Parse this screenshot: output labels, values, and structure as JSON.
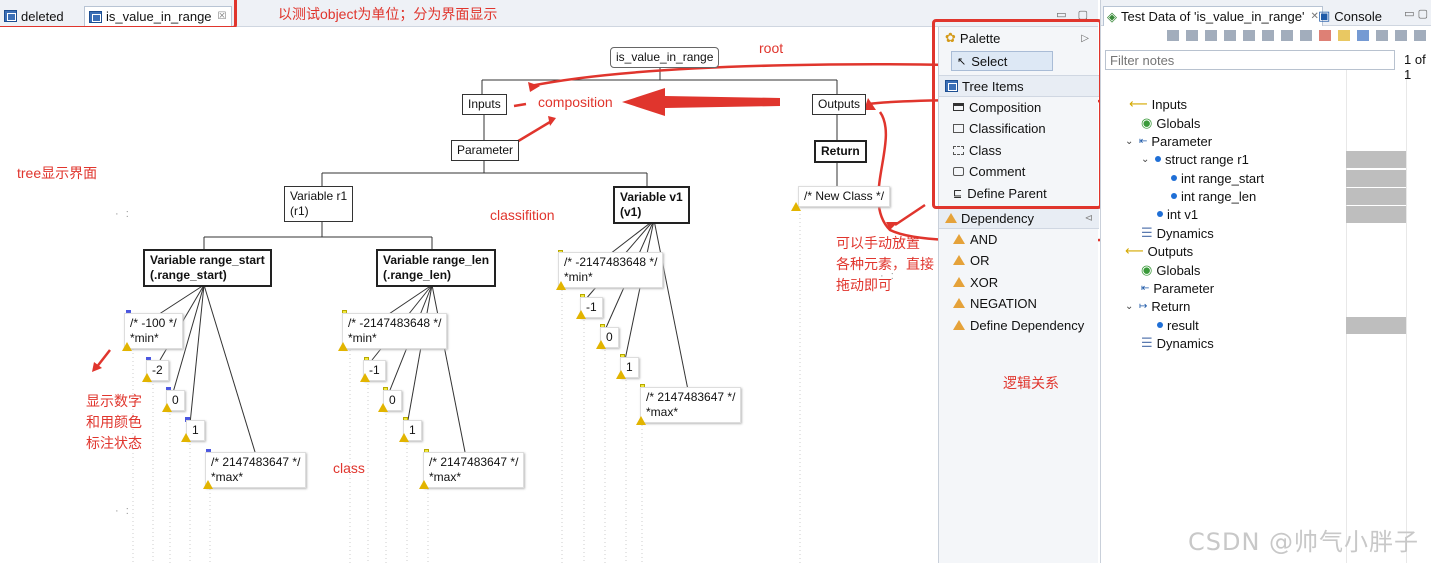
{
  "editor": {
    "tabs": [
      {
        "label": "deleted",
        "icon": "classification-tree-icon"
      },
      {
        "label": "is_value_in_range",
        "icon": "classification-tree-icon",
        "close": "☒"
      }
    ]
  },
  "tree": {
    "root": "is_value_in_range",
    "inputs": "Inputs",
    "outputs": "Outputs",
    "parameter": "Parameter",
    "return": "Return",
    "var_r1": [
      "Variable r1",
      "(r1)"
    ],
    "var_v1": [
      "Variable v1",
      "(v1)"
    ],
    "new_class": "/* New Class */",
    "var_range_start": [
      "Variable range_start",
      "(.range_start)"
    ],
    "var_range_len": [
      "Variable range_len",
      "(.range_len)"
    ],
    "rs_classes": [
      "/* -100 */",
      "*min*",
      "-2",
      "0",
      "1",
      "/* 2147483647 */",
      "*max*"
    ],
    "rl_classes": [
      "/* -2147483648 */",
      "*min*",
      "-1",
      "0",
      "1",
      "/* 2147483647 */",
      "*max*"
    ],
    "v1_classes": [
      "/* -2147483648 */",
      "*min*",
      "-1",
      "0",
      "1",
      "/* 2147483647 */",
      "*max*"
    ]
  },
  "annotations": {
    "title_note": "以测试object为单位；分为界面显示",
    "root": "root",
    "composition": "composition",
    "tree_ui": "tree显示界面",
    "classification": "classifition",
    "class": "class",
    "numbers": [
      "显示数字",
      "和用颜色",
      "标注状态"
    ],
    "drag": [
      "可以手动放置",
      "各种元素，直接",
      "拖动即可"
    ],
    "logic": "逻辑关系"
  },
  "palette": {
    "title": "Palette",
    "select": "Select",
    "tree_items_title": "Tree Items",
    "tree_items": [
      "Composition",
      "Classification",
      "Class",
      "Comment",
      "Define Parent"
    ],
    "dependency_title": "Dependency",
    "dependency_items": [
      "AND",
      "OR",
      "XOR",
      "NEGATION",
      "Define Dependency"
    ]
  },
  "test_data": {
    "tab_label": "Test Data of 'is_value_in_range'",
    "console_label": "Console",
    "filter_placeholder": "Filter notes",
    "page": "1 of 1",
    "rows": [
      "Inputs",
      "Globals",
      "Parameter",
      "struct range r1",
      "int range_start",
      "int range_len",
      "int v1",
      "Dynamics",
      "Outputs",
      "Globals",
      "Parameter",
      "Return",
      "result",
      "Dynamics"
    ]
  },
  "watermark": "CSDN @帅气小胖子",
  "colors": {
    "annotation": "#e0352d",
    "warning": "#e2b400",
    "blue_marker": "#4a56e0",
    "yellow_marker": "#f2ea3a"
  }
}
